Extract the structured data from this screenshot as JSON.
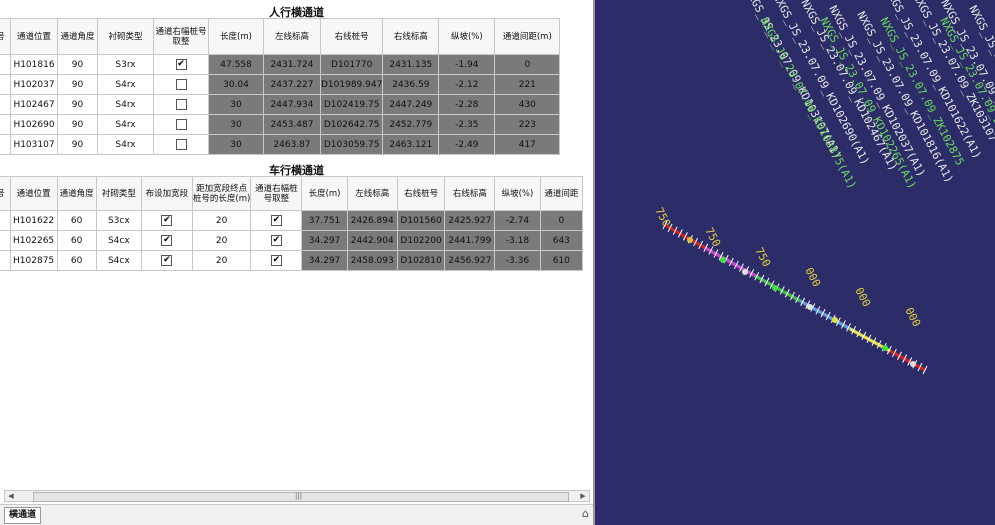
{
  "pedestrian": {
    "title": "人行横通道",
    "columns": [
      "号",
      "通道位置",
      "通道角度",
      "衬砌类型",
      "通道右幅桩号取整",
      "长度(m)",
      "左线标高",
      "右线桩号",
      "右线标高",
      "纵坡(%)",
      "通道间距(m)"
    ],
    "rows": [
      {
        "pos": "H101816",
        "angle": "90",
        "lining": "S3rx",
        "checked": true,
        "length": "47.558",
        "left_elev": "2431.724",
        "right_station": "D101770",
        "right_elev": "2431.135",
        "slope": "-1.94",
        "spacing": "0"
      },
      {
        "pos": "H102037",
        "angle": "90",
        "lining": "S4rx",
        "checked": false,
        "length": "30.04",
        "left_elev": "2437.227",
        "right_station": "D101989.947",
        "right_elev": "2436.59",
        "slope": "-2.12",
        "spacing": "221"
      },
      {
        "pos": "H102467",
        "angle": "90",
        "lining": "S4rx",
        "checked": false,
        "length": "30",
        "left_elev": "2447.934",
        "right_station": "D102419.75",
        "right_elev": "2447.249",
        "slope": "-2.28",
        "spacing": "430"
      },
      {
        "pos": "H102690",
        "angle": "90",
        "lining": "S4rx",
        "checked": false,
        "length": "30",
        "left_elev": "2453.487",
        "right_station": "D102642.75",
        "right_elev": "2452.779",
        "slope": "-2.35",
        "spacing": "223"
      },
      {
        "pos": "H103107",
        "angle": "90",
        "lining": "S4rx",
        "checked": false,
        "length": "30",
        "left_elev": "2463.87",
        "right_station": "D103059.75",
        "right_elev": "2463.121",
        "slope": "-2.49",
        "spacing": "417"
      }
    ]
  },
  "vehicle": {
    "title": "车行横通道",
    "columns": [
      "号",
      "通道位置",
      "通道角度",
      "衬砌类型",
      "布设加宽段",
      "距加宽段终点桩号的长度(m)",
      "通道右幅桩号取整",
      "长度(m)",
      "左线标高",
      "右线桩号",
      "右线标高",
      "纵坡(%)",
      "通道间距"
    ],
    "rows": [
      {
        "pos": "H101622",
        "angle": "60",
        "lining": "S3cx",
        "widen": true,
        "dist": "20",
        "checked": true,
        "length": "37.751",
        "left_elev": "2426.894",
        "right_station": "D101560",
        "right_elev": "2425.927",
        "slope": "-2.74",
        "spacing": "0"
      },
      {
        "pos": "H102265",
        "angle": "60",
        "lining": "S4cx",
        "widen": true,
        "dist": "20",
        "checked": true,
        "length": "34.297",
        "left_elev": "2442.904",
        "right_station": "D102200",
        "right_elev": "2441.799",
        "slope": "-3.18",
        "spacing": "643"
      },
      {
        "pos": "H102875",
        "angle": "60",
        "lining": "S4cx",
        "widen": true,
        "dist": "20",
        "checked": true,
        "length": "34.297",
        "left_elev": "2458.093",
        "right_station": "D102810",
        "right_elev": "2456.927",
        "slope": "-3.36",
        "spacing": "610"
      }
    ]
  },
  "checkmark": "✔",
  "scrollbar": {
    "left_arrow": "◀",
    "right_arrow": "▶",
    "grip": "|||"
  },
  "bottom": {
    "tab_label": "横通道",
    "home_icon": "⌂"
  },
  "viewer": {
    "bg_color": "#2c2c68",
    "labels_white": [
      "NXGS_JS_23.07.09_KD103107(A1)",
      "NXGS_JS_23.07.09_KD102690(A1)",
      "NXGS_JS_23.07.09_KD102467(A1)",
      "NXGS_JS_23.07.09_KD102037(A1)",
      "NXGS_JS_23.07.09_KD101816(A1)",
      "NXGS_JS_23.07.09_KD101622(A1)",
      "NXGS_JS_23.07.09_ZK103107",
      "NXGS_JS_23.07.09_ZK102690",
      "NXGS_JS_23.07.09_ZK102467",
      "NXGS_JS_23.07.09_ZK102037"
    ],
    "labels_green": [
      "NXGS_JS_23.07.09_KD102875(A1)",
      "NXGS_JS_23.07.09_KD102265(A1)",
      "NXGS_JS_23.07.09_ZK102875",
      "NXGS_JS_23.07.09_ZK102265"
    ],
    "labels_yellow": [
      "750",
      "750",
      "750",
      "000",
      "000",
      "000"
    ]
  }
}
